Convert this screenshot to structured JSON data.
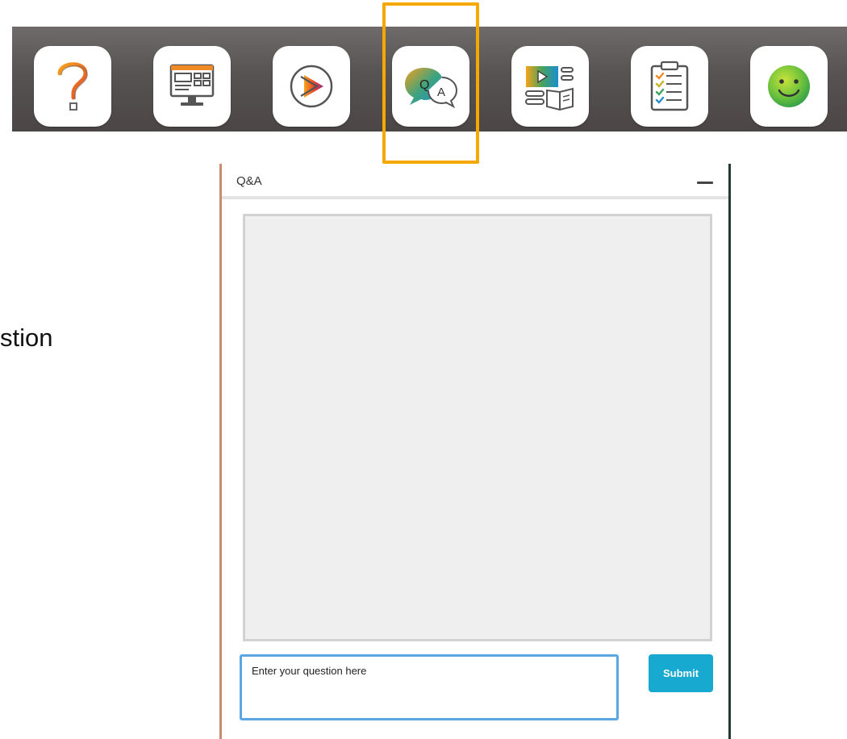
{
  "dock": {
    "items": [
      {
        "icon": "help-question-icon"
      },
      {
        "icon": "slides-desktop-icon"
      },
      {
        "icon": "media-player-icon"
      },
      {
        "icon": "qa-chat-icon",
        "selected": true
      },
      {
        "icon": "resources-book-icon"
      },
      {
        "icon": "survey-checklist-icon"
      },
      {
        "icon": "feedback-smiley-icon"
      }
    ],
    "highlight_color": "#f5a800"
  },
  "slide": {
    "partial_text": "stion"
  },
  "qa_panel": {
    "title": "Q&A",
    "input_placeholder": "Enter your question here",
    "submit_label": "Submit"
  },
  "colors": {
    "submit": "#17a9cf",
    "input_border": "#5aa7e6",
    "messages_bg": "#efefef"
  }
}
